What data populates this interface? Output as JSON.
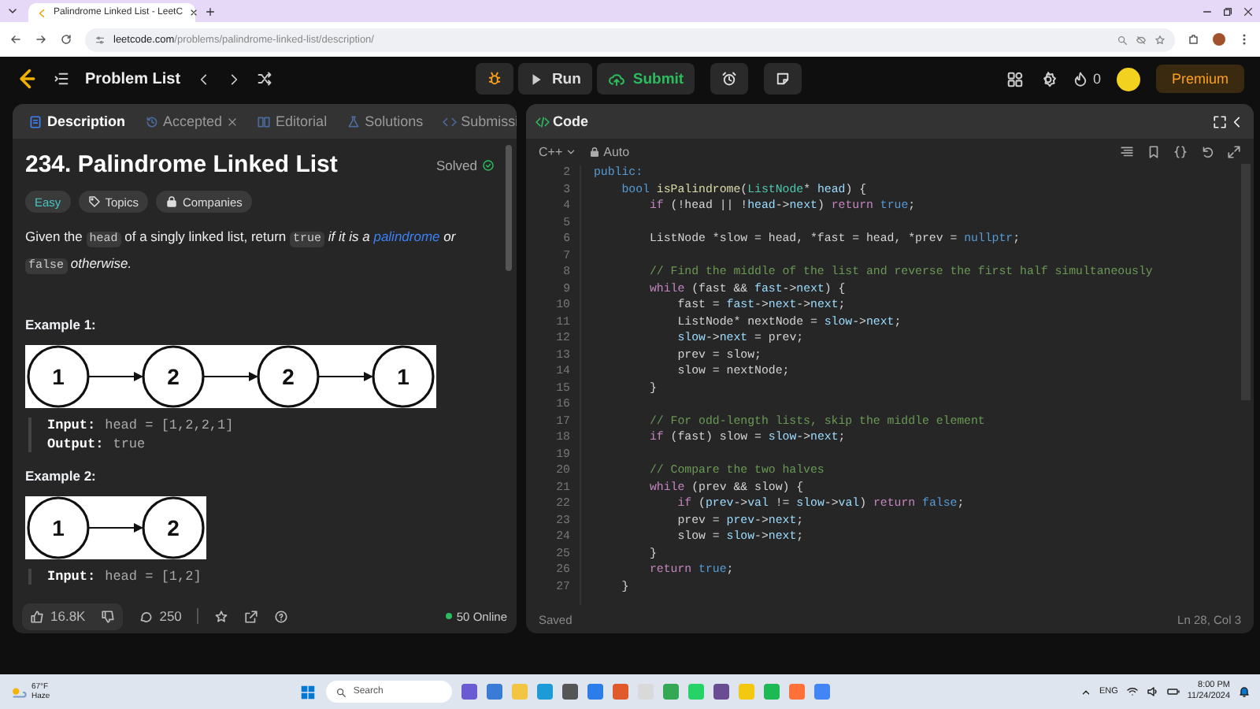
{
  "browser": {
    "tab_title": "Palindrome Linked List - LeetC",
    "url_domain": "leetcode.com",
    "url_path": "/problems/palindrome-linked-list/description/"
  },
  "header": {
    "problem_list": "Problem List",
    "run": "Run",
    "submit": "Submit",
    "streak": "0",
    "premium": "Premium"
  },
  "left_tabs": [
    {
      "label": "Description",
      "selected": true,
      "closable": false
    },
    {
      "label": "Accepted",
      "selected": false,
      "closable": true
    },
    {
      "label": "Editorial",
      "selected": false,
      "closable": false
    },
    {
      "label": "Solutions",
      "selected": false,
      "closable": false
    },
    {
      "label": "Submissi",
      "selected": false,
      "closable": false
    }
  ],
  "problem": {
    "title": "234. Palindrome Linked List",
    "status": "Solved",
    "difficulty": "Easy",
    "tags": [
      "Topics",
      "Companies"
    ],
    "description": [
      {
        "kind": "text",
        "text": "Given the "
      },
      {
        "kind": "code",
        "text": "head"
      },
      {
        "kind": "text",
        "text": " of a singly linked list, return "
      },
      {
        "kind": "code",
        "text": "true"
      },
      {
        "kind": "italic",
        "text": " if it is a "
      },
      {
        "kind": "link",
        "text": "palindrome"
      },
      {
        "kind": "italic",
        "text": " or "
      },
      {
        "kind": "code",
        "text": "false"
      },
      {
        "kind": "italic",
        "text": " otherwise."
      }
    ],
    "examples": [
      {
        "heading": "Example 1:",
        "nodes": [
          "1",
          "2",
          "2",
          "1"
        ],
        "io": [
          {
            "label": "Input:",
            "value": "head = [1,2,2,1]"
          },
          {
            "label": "Output:",
            "value": "true"
          }
        ]
      },
      {
        "heading": "Example 2:",
        "nodes": [
          "1",
          "2"
        ],
        "io": [
          {
            "label": "Input:",
            "value": "head = [1,2]"
          }
        ]
      }
    ]
  },
  "footer": {
    "likes": "16.8K",
    "comments": "250",
    "online": "50 Online"
  },
  "editor": {
    "title": "Code",
    "language": "C++",
    "mode": "Auto",
    "status": "Saved",
    "cursor": "Ln 28, Col 3",
    "lines": [
      {
        "num": "2",
        "tokens": [
          {
            "kind": "type",
            "text": "public:"
          }
        ]
      },
      {
        "num": "3",
        "tokens": [
          {
            "kind": "type",
            "text": "    bool "
          },
          {
            "kind": "fn",
            "text": "isPalindrome"
          },
          {
            "kind": "plain",
            "text": "("
          },
          {
            "kind": "cls",
            "text": "ListNode"
          },
          {
            "kind": "plain",
            "text": "* "
          },
          {
            "kind": "var",
            "text": "head"
          },
          {
            "kind": "plain",
            "text": ") {"
          }
        ]
      },
      {
        "num": "4",
        "tokens": [
          {
            "kind": "kw",
            "text": "        if"
          },
          {
            "kind": "plain",
            "text": " (!head || !"
          },
          {
            "kind": "var",
            "text": "head"
          },
          {
            "kind": "plain",
            "text": "->"
          },
          {
            "kind": "var",
            "text": "next"
          },
          {
            "kind": "plain",
            "text": ") "
          },
          {
            "kind": "kw",
            "text": "return"
          },
          {
            "kind": "const",
            "text": " true"
          },
          {
            "kind": "plain",
            "text": ";"
          }
        ]
      },
      {
        "num": "5"
      },
      {
        "num": "6",
        "tokens": [
          {
            "kind": "plain",
            "text": "        ListNode *slow = head, *fast = head, *prev = "
          },
          {
            "kind": "const",
            "text": "nullptr"
          },
          {
            "kind": "plain",
            "text": ";"
          }
        ]
      },
      {
        "num": "7"
      },
      {
        "num": "8",
        "tokens": [
          {
            "kind": "comment",
            "text": "        // Find the middle of the list and reverse the first half simultaneously"
          }
        ]
      },
      {
        "num": "9",
        "tokens": [
          {
            "kind": "kw",
            "text": "        while"
          },
          {
            "kind": "plain",
            "text": " (fast && "
          },
          {
            "kind": "var",
            "text": "fast"
          },
          {
            "kind": "plain",
            "text": "->"
          },
          {
            "kind": "var",
            "text": "next"
          },
          {
            "kind": "plain",
            "text": ") {"
          }
        ]
      },
      {
        "num": "10",
        "tokens": [
          {
            "kind": "plain",
            "text": "            fast = "
          },
          {
            "kind": "var",
            "text": "fast"
          },
          {
            "kind": "plain",
            "text": "->"
          },
          {
            "kind": "var",
            "text": "next"
          },
          {
            "kind": "plain",
            "text": "->"
          },
          {
            "kind": "var",
            "text": "next"
          },
          {
            "kind": "plain",
            "text": ";"
          }
        ]
      },
      {
        "num": "11",
        "tokens": [
          {
            "kind": "plain",
            "text": "            ListNode* nextNode = "
          },
          {
            "kind": "var",
            "text": "slow"
          },
          {
            "kind": "plain",
            "text": "->"
          },
          {
            "kind": "var",
            "text": "next"
          },
          {
            "kind": "plain",
            "text": ";"
          }
        ]
      },
      {
        "num": "12",
        "tokens": [
          {
            "kind": "var",
            "text": "            slow"
          },
          {
            "kind": "plain",
            "text": "->"
          },
          {
            "kind": "var",
            "text": "next"
          },
          {
            "kind": "plain",
            "text": " = prev;"
          }
        ]
      },
      {
        "num": "13",
        "tokens": [
          {
            "kind": "plain",
            "text": "            prev = slow;"
          }
        ]
      },
      {
        "num": "14",
        "tokens": [
          {
            "kind": "plain",
            "text": "            slow = nextNode;"
          }
        ]
      },
      {
        "num": "15",
        "tokens": [
          {
            "kind": "plain",
            "text": "        }"
          }
        ]
      },
      {
        "num": "16"
      },
      {
        "num": "17",
        "tokens": [
          {
            "kind": "comment",
            "text": "        // For odd-length lists, skip the middle element"
          }
        ]
      },
      {
        "num": "18",
        "tokens": [
          {
            "kind": "kw",
            "text": "        if"
          },
          {
            "kind": "plain",
            "text": " (fast) slow = "
          },
          {
            "kind": "var",
            "text": "slow"
          },
          {
            "kind": "plain",
            "text": "->"
          },
          {
            "kind": "var",
            "text": "next"
          },
          {
            "kind": "plain",
            "text": ";"
          }
        ]
      },
      {
        "num": "19"
      },
      {
        "num": "20",
        "tokens": [
          {
            "kind": "comment",
            "text": "        // Compare the two halves"
          }
        ]
      },
      {
        "num": "21",
        "tokens": [
          {
            "kind": "kw",
            "text": "        while"
          },
          {
            "kind": "plain",
            "text": " (prev && slow) {"
          }
        ]
      },
      {
        "num": "22",
        "tokens": [
          {
            "kind": "kw",
            "text": "            if"
          },
          {
            "kind": "plain",
            "text": " ("
          },
          {
            "kind": "var",
            "text": "prev"
          },
          {
            "kind": "plain",
            "text": "->"
          },
          {
            "kind": "var",
            "text": "val"
          },
          {
            "kind": "plain",
            "text": " != "
          },
          {
            "kind": "var",
            "text": "slow"
          },
          {
            "kind": "plain",
            "text": "->"
          },
          {
            "kind": "var",
            "text": "val"
          },
          {
            "kind": "plain",
            "text": ") "
          },
          {
            "kind": "kw",
            "text": "return"
          },
          {
            "kind": "const",
            "text": " false"
          },
          {
            "kind": "plain",
            "text": ";"
          }
        ]
      },
      {
        "num": "23",
        "tokens": [
          {
            "kind": "plain",
            "text": "            prev = "
          },
          {
            "kind": "var",
            "text": "prev"
          },
          {
            "kind": "plain",
            "text": "->"
          },
          {
            "kind": "var",
            "text": "next"
          },
          {
            "kind": "plain",
            "text": ";"
          }
        ]
      },
      {
        "num": "24",
        "tokens": [
          {
            "kind": "plain",
            "text": "            slow = "
          },
          {
            "kind": "var",
            "text": "slow"
          },
          {
            "kind": "plain",
            "text": "->"
          },
          {
            "kind": "var",
            "text": "next"
          },
          {
            "kind": "plain",
            "text": ";"
          }
        ]
      },
      {
        "num": "25",
        "tokens": [
          {
            "kind": "plain",
            "text": "        }"
          }
        ]
      },
      {
        "num": "26",
        "tokens": [
          {
            "kind": "kw",
            "text": "        return"
          },
          {
            "kind": "const",
            "text": " true"
          },
          {
            "kind": "plain",
            "text": ";"
          }
        ]
      },
      {
        "num": "27",
        "tokens": [
          {
            "kind": "plain",
            "text": "    }"
          }
        ]
      }
    ]
  },
  "taskbar": {
    "temperature": "67°F",
    "weather": "Haze",
    "search": "Search",
    "language": "ENG",
    "time": "8:00 PM",
    "date": "11/24/2024"
  }
}
